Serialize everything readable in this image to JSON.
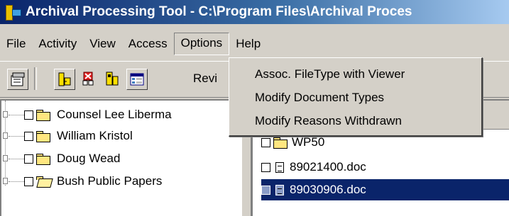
{
  "window": {
    "title": "Archival Processing Tool - C:\\Program Files\\Archival Proces",
    "icon": "app-icon"
  },
  "menubar": {
    "items": [
      "File",
      "Activity",
      "View",
      "Access",
      "Options",
      "Help"
    ],
    "open_item": "Options"
  },
  "options_menu": {
    "items": [
      "Assoc. FileType with Viewer",
      "Modify Document Types",
      "Modify Reasons Withdrawn"
    ]
  },
  "toolbar": {
    "label": "Revi",
    "icons": [
      "properties-icon",
      "collection-icon",
      "withdraw-icon",
      "review-icon",
      "list-view-icon"
    ]
  },
  "tree": {
    "items": [
      {
        "label": "Counsel Lee Liberma",
        "checked": false,
        "folder": "closed"
      },
      {
        "label": "William Kristol",
        "checked": false,
        "folder": "closed"
      },
      {
        "label": "Doug Wead",
        "checked": false,
        "folder": "closed"
      },
      {
        "label": "Bush Public Papers",
        "checked": false,
        "folder": "open"
      }
    ]
  },
  "files": {
    "items": [
      {
        "label": "WP50",
        "type": "folder",
        "selected": false
      },
      {
        "label": "89021400.doc",
        "type": "document",
        "selected": false
      },
      {
        "label": "89030906.doc",
        "type": "document",
        "selected": true
      }
    ]
  },
  "colors": {
    "title_gradient_start": "#0a246a",
    "title_gradient_end": "#a6caf0",
    "selection": "#0a246a",
    "face": "#d4d0c8"
  }
}
